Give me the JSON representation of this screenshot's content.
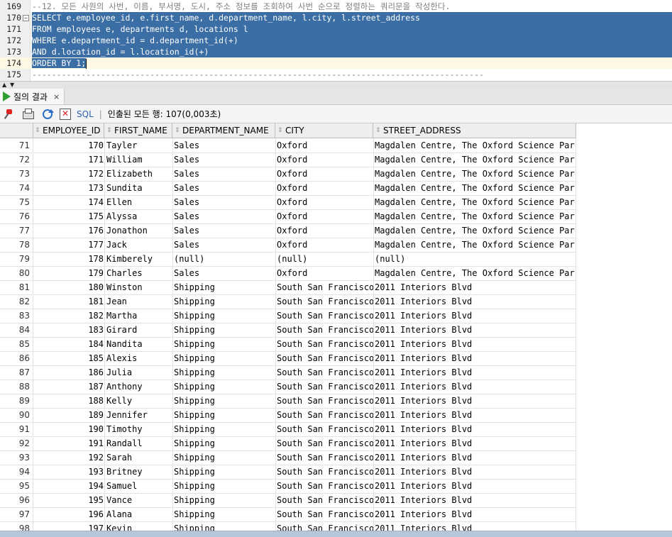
{
  "editor": {
    "lines": [
      {
        "num": "169",
        "text": "--12. 모든 사원의 사번, 이름, 부서명, 도시, 주소 정보를 조회하여 사번 순으로 정렬하는 쿼리문을 작성한다."
      },
      {
        "num": "170",
        "text": "SELECT e.employee_id, e.first_name, d.department_name, l.city, l.street_address"
      },
      {
        "num": "171",
        "text": "FROM employees e, departments d, locations l"
      },
      {
        "num": "172",
        "text": "WHERE e.department_id = d.department_id(+)"
      },
      {
        "num": "173",
        "text": "AND d.location_id = l.location_id(+)"
      },
      {
        "num": "174",
        "text": "ORDER BY 1;"
      },
      {
        "num": "175",
        "text": "--------------------------------------------------------------------------------------------"
      }
    ]
  },
  "results_tab": {
    "label": "질의 결과",
    "close": "×"
  },
  "toolbar": {
    "sql_label": "SQL",
    "separator": "|",
    "fetch_text": "인출된 모든 행: 107(0,003초)"
  },
  "grid": {
    "columns": [
      "EMPLOYEE_ID",
      "FIRST_NAME",
      "DEPARTMENT_NAME",
      "CITY",
      "STREET_ADDRESS"
    ],
    "rows": [
      [
        "71",
        "170",
        "Tayler",
        "Sales",
        "Oxford",
        "Magdalen Centre, The Oxford Science Park"
      ],
      [
        "72",
        "171",
        "William",
        "Sales",
        "Oxford",
        "Magdalen Centre, The Oxford Science Park"
      ],
      [
        "73",
        "172",
        "Elizabeth",
        "Sales",
        "Oxford",
        "Magdalen Centre, The Oxford Science Park"
      ],
      [
        "74",
        "173",
        "Sundita",
        "Sales",
        "Oxford",
        "Magdalen Centre, The Oxford Science Park"
      ],
      [
        "75",
        "174",
        "Ellen",
        "Sales",
        "Oxford",
        "Magdalen Centre, The Oxford Science Park"
      ],
      [
        "76",
        "175",
        "Alyssa",
        "Sales",
        "Oxford",
        "Magdalen Centre, The Oxford Science Park"
      ],
      [
        "77",
        "176",
        "Jonathon",
        "Sales",
        "Oxford",
        "Magdalen Centre, The Oxford Science Park"
      ],
      [
        "78",
        "177",
        "Jack",
        "Sales",
        "Oxford",
        "Magdalen Centre, The Oxford Science Park"
      ],
      [
        "79",
        "178",
        "Kimberely",
        "(null)",
        "(null)",
        "(null)"
      ],
      [
        "80",
        "179",
        "Charles",
        "Sales",
        "Oxford",
        "Magdalen Centre, The Oxford Science Park"
      ],
      [
        "81",
        "180",
        "Winston",
        "Shipping",
        "South San Francisco",
        "2011 Interiors Blvd"
      ],
      [
        "82",
        "181",
        "Jean",
        "Shipping",
        "South San Francisco",
        "2011 Interiors Blvd"
      ],
      [
        "83",
        "182",
        "Martha",
        "Shipping",
        "South San Francisco",
        "2011 Interiors Blvd"
      ],
      [
        "84",
        "183",
        "Girard",
        "Shipping",
        "South San Francisco",
        "2011 Interiors Blvd"
      ],
      [
        "85",
        "184",
        "Nandita",
        "Shipping",
        "South San Francisco",
        "2011 Interiors Blvd"
      ],
      [
        "86",
        "185",
        "Alexis",
        "Shipping",
        "South San Francisco",
        "2011 Interiors Blvd"
      ],
      [
        "87",
        "186",
        "Julia",
        "Shipping",
        "South San Francisco",
        "2011 Interiors Blvd"
      ],
      [
        "88",
        "187",
        "Anthony",
        "Shipping",
        "South San Francisco",
        "2011 Interiors Blvd"
      ],
      [
        "89",
        "188",
        "Kelly",
        "Shipping",
        "South San Francisco",
        "2011 Interiors Blvd"
      ],
      [
        "90",
        "189",
        "Jennifer",
        "Shipping",
        "South San Francisco",
        "2011 Interiors Blvd"
      ],
      [
        "91",
        "190",
        "Timothy",
        "Shipping",
        "South San Francisco",
        "2011 Interiors Blvd"
      ],
      [
        "92",
        "191",
        "Randall",
        "Shipping",
        "South San Francisco",
        "2011 Interiors Blvd"
      ],
      [
        "93",
        "192",
        "Sarah",
        "Shipping",
        "South San Francisco",
        "2011 Interiors Blvd"
      ],
      [
        "94",
        "193",
        "Britney",
        "Shipping",
        "South San Francisco",
        "2011 Interiors Blvd"
      ],
      [
        "95",
        "194",
        "Samuel",
        "Shipping",
        "South San Francisco",
        "2011 Interiors Blvd"
      ],
      [
        "96",
        "195",
        "Vance",
        "Shipping",
        "South San Francisco",
        "2011 Interiors Blvd"
      ],
      [
        "97",
        "196",
        "Alana",
        "Shipping",
        "South San Francisco",
        "2011 Interiors Blvd"
      ],
      [
        "98",
        "197",
        "Kevin",
        "Shipping",
        "South San Francisco",
        "2011 Interiors Blvd"
      ]
    ]
  },
  "colors": {
    "selection": "#3a6ea5",
    "current_line": "#fdf7e3",
    "run_icon": "#2fa02f",
    "sql_link": "#2b5fb4"
  },
  "icons": [
    "play-icon",
    "pin-icon",
    "print-icon",
    "refresh-icon",
    "cancel-icon",
    "sort-icon",
    "fold-icon"
  ]
}
